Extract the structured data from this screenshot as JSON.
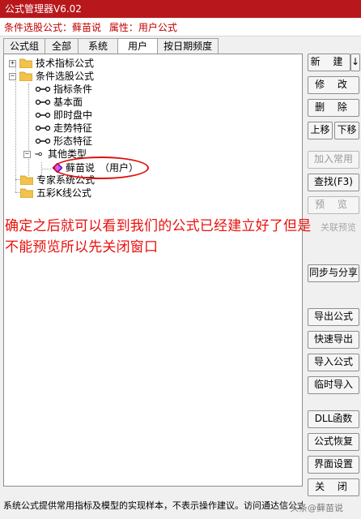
{
  "window": {
    "title": "公式管理器V6.02"
  },
  "infobar": {
    "formula_label": "条件选股公式：",
    "formula_name": "藓苗说",
    "attr_label": "属性：",
    "attr_value": "用户公式"
  },
  "tabs": [
    {
      "label": "公式组"
    },
    {
      "label": "全部"
    },
    {
      "label": "系统"
    },
    {
      "label": "用户"
    },
    {
      "label": "按日期频度"
    }
  ],
  "active_tab": "用户",
  "tree": {
    "nodes": [
      {
        "label": "技术指标公式",
        "expander": "+"
      },
      {
        "label": "条件选股公式",
        "expander": "−"
      },
      {
        "label": "指标条件"
      },
      {
        "label": "基本面"
      },
      {
        "label": "即时盘中"
      },
      {
        "label": "走势特征"
      },
      {
        "label": "形态特征"
      },
      {
        "label": "其他类型",
        "expander": "−"
      },
      {
        "label": "藓苗说　（用户）"
      },
      {
        "label": "专家系统公式"
      },
      {
        "label": "五彩K线公式"
      }
    ]
  },
  "annotation": {
    "text": "确定之后就可以看到我们的公式已经建立好了但是不能预览所以先关闭窗口",
    "color": "#e8100c"
  },
  "buttons": {
    "new": "新 建",
    "new_arrow": "↓",
    "modify": "修 改",
    "delete": "删 除",
    "move_up": "上移",
    "move_down": "下移",
    "add_common": "加入常用",
    "find": "查找(F3)",
    "preview": "预 览",
    "related_preview": "关联预览",
    "sync_share": "同步与分享",
    "export": "导出公式",
    "quick_export": "快速导出",
    "import": "导入公式",
    "temp_import": "临时导入",
    "dll": "DLL函数",
    "restore": "公式恢复",
    "ui_settings": "界面设置",
    "close": "关 闭"
  },
  "status": {
    "text": "系统公式提供常用指标及模型的实现样本，不表示操作建议。访问通达信公式社区"
  },
  "watermark": "头条@藓苗说",
  "colors": {
    "titlebar": "#b8181c",
    "infobar_text": "#c00000",
    "folder": "#f2c24a",
    "diamond": "#8a2be2"
  }
}
